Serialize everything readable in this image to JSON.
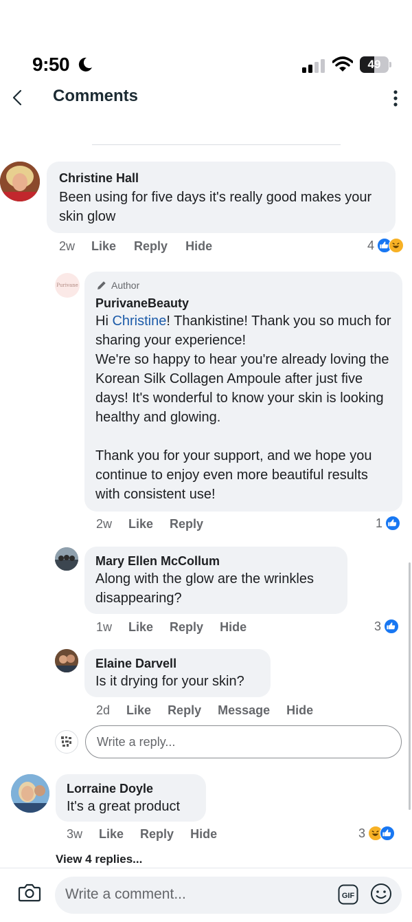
{
  "status_bar": {
    "time": "9:50",
    "battery": "49",
    "battery_level": 0.49
  },
  "header": {
    "title": "Comments"
  },
  "comments": [
    {
      "name": "Christine Hall",
      "text": "Been using for five days it's really good makes your skin glow",
      "time": "2w",
      "like": "Like",
      "reply": "Reply",
      "hide": "Hide",
      "reaction_count": "4",
      "reactions": [
        "like-icon",
        "haha-icon"
      ]
    },
    {
      "author_badge": "Author",
      "avatar_text": "Purivane",
      "name": "PurivaneBeauty",
      "mention": "Christine",
      "text_greeting": "Hi ",
      "text_rest": "! Thankistine! Thank you so much for sharing your experience!\nWe're so happy to hear you're already loving the Korean Silk Collagen Ampoule after just five days! It's wonderful to know your skin is looking healthy and glowing.\n\nThank you for your support, and we hope you continue to enjoy even more beautiful results with consistent use!",
      "time": "2w",
      "like": "Like",
      "reply": "Reply",
      "reaction_count": "1",
      "reactions": [
        "like-icon"
      ]
    },
    {
      "name": "Mary Ellen McCollum",
      "text": "Along with the glow are the wrinkles disappearing?",
      "time": "1w",
      "like": "Like",
      "reply": "Reply",
      "hide": "Hide",
      "reaction_count": "3",
      "reactions": [
        "like-icon"
      ]
    },
    {
      "name": "Elaine Darvell",
      "text": "Is it drying for your skin?",
      "time": "2d",
      "like": "Like",
      "reply": "Reply",
      "message": "Message",
      "hide": "Hide"
    },
    {
      "name": "Lorraine Doyle",
      "text": "It's a great product",
      "time": "3w",
      "like": "Like",
      "reply": "Reply",
      "hide": "Hide",
      "reaction_count": "3",
      "reactions": [
        "haha-icon",
        "like-icon"
      ]
    }
  ],
  "reply_box": {
    "placeholder": "Write a reply..."
  },
  "view_replies": "View 4 replies...",
  "composer": {
    "placeholder": "Write a comment...",
    "gif_label": "GIF"
  },
  "colors": {
    "like_blue": "#1877f2",
    "bubble_bg": "#f0f2f5",
    "mention": "#1b5aa8"
  }
}
